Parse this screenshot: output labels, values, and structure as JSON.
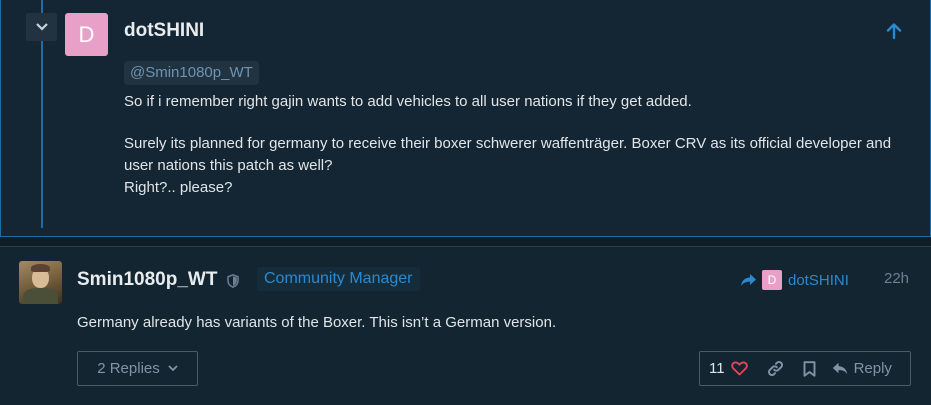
{
  "embedded_post": {
    "avatar_letter": "D",
    "username": "dotSHINI",
    "mention": "@Smin1080p_WT",
    "paragraphs": [
      "So if i remember right gajin wants to add vehicles to all user nations if they get added.",
      "Surely its planned for germany to receive their boxer schwerer waffenträger. Boxer CRV as its official developer and user nations this patch as well?\nRight?.. please?"
    ]
  },
  "post": {
    "username": "Smin1080p_WT",
    "role": "Community Manager",
    "reply_to": {
      "avatar_letter": "D",
      "username": "dotSHINI"
    },
    "timestamp": "22h",
    "body": "Germany already has variants of the Boxer. This isn’t a German version.",
    "replies_label": "2 Replies",
    "like_count": "11",
    "reply_label": "Reply"
  },
  "colors": {
    "accent": "#2a8ad1",
    "thread_line": "#1a6fa8",
    "like_heart": "#e0455a",
    "avatar_pink": "#e8a0c8"
  },
  "icons": [
    "chevron-down-icon",
    "arrow-up-icon",
    "shield-icon",
    "share-icon",
    "heart-icon",
    "link-icon",
    "bookmark-icon",
    "reply-icon"
  ]
}
